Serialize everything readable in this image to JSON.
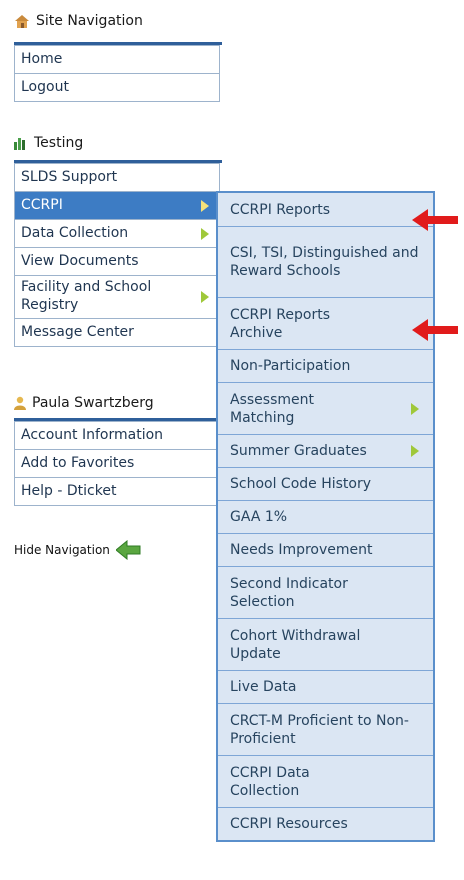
{
  "site_nav": {
    "title": "Site Navigation",
    "items": [
      {
        "label": "Home"
      },
      {
        "label": "Logout"
      }
    ]
  },
  "testing": {
    "title": "Testing",
    "items": [
      {
        "label": "SLDS Support"
      },
      {
        "label": "CCRPI"
      },
      {
        "label": "Data Collection"
      },
      {
        "label": "View Documents"
      },
      {
        "label": "Facility and School Registry"
      },
      {
        "label": "Message Center"
      }
    ]
  },
  "user": {
    "name": "Paula Swartzberg",
    "items": [
      {
        "label": "Account Information"
      },
      {
        "label": "Add to Favorites"
      },
      {
        "label": "Help - Dticket"
      }
    ]
  },
  "hide_navigation": {
    "label": "Hide Navigation"
  },
  "ccrpi_submenu": {
    "items": [
      {
        "label": "CCRPI Reports"
      },
      {
        "label": "CSI, TSI, Distinguished and Reward Schools"
      },
      {
        "label": "CCRPI Reports Archive"
      },
      {
        "label": "Non-Participation"
      },
      {
        "label": "Assessment Matching"
      },
      {
        "label": "Summer Graduates"
      },
      {
        "label": "School Code History"
      },
      {
        "label": "GAA 1%"
      },
      {
        "label": "Needs Improvement"
      },
      {
        "label": "Second Indicator Selection"
      },
      {
        "label": "Cohort Withdrawal Update"
      },
      {
        "label": "Live Data"
      },
      {
        "label": "CRCT-M Proficient to Non-Proficient"
      },
      {
        "label": "CCRPI Data Collection"
      },
      {
        "label": "CCRPI Resources"
      }
    ]
  },
  "colors": {
    "accent": "#3d7cc4",
    "submenu_bg": "#dbe6f3",
    "arrow_red": "#e11b1b",
    "arrow_green": "#9fc83a"
  }
}
